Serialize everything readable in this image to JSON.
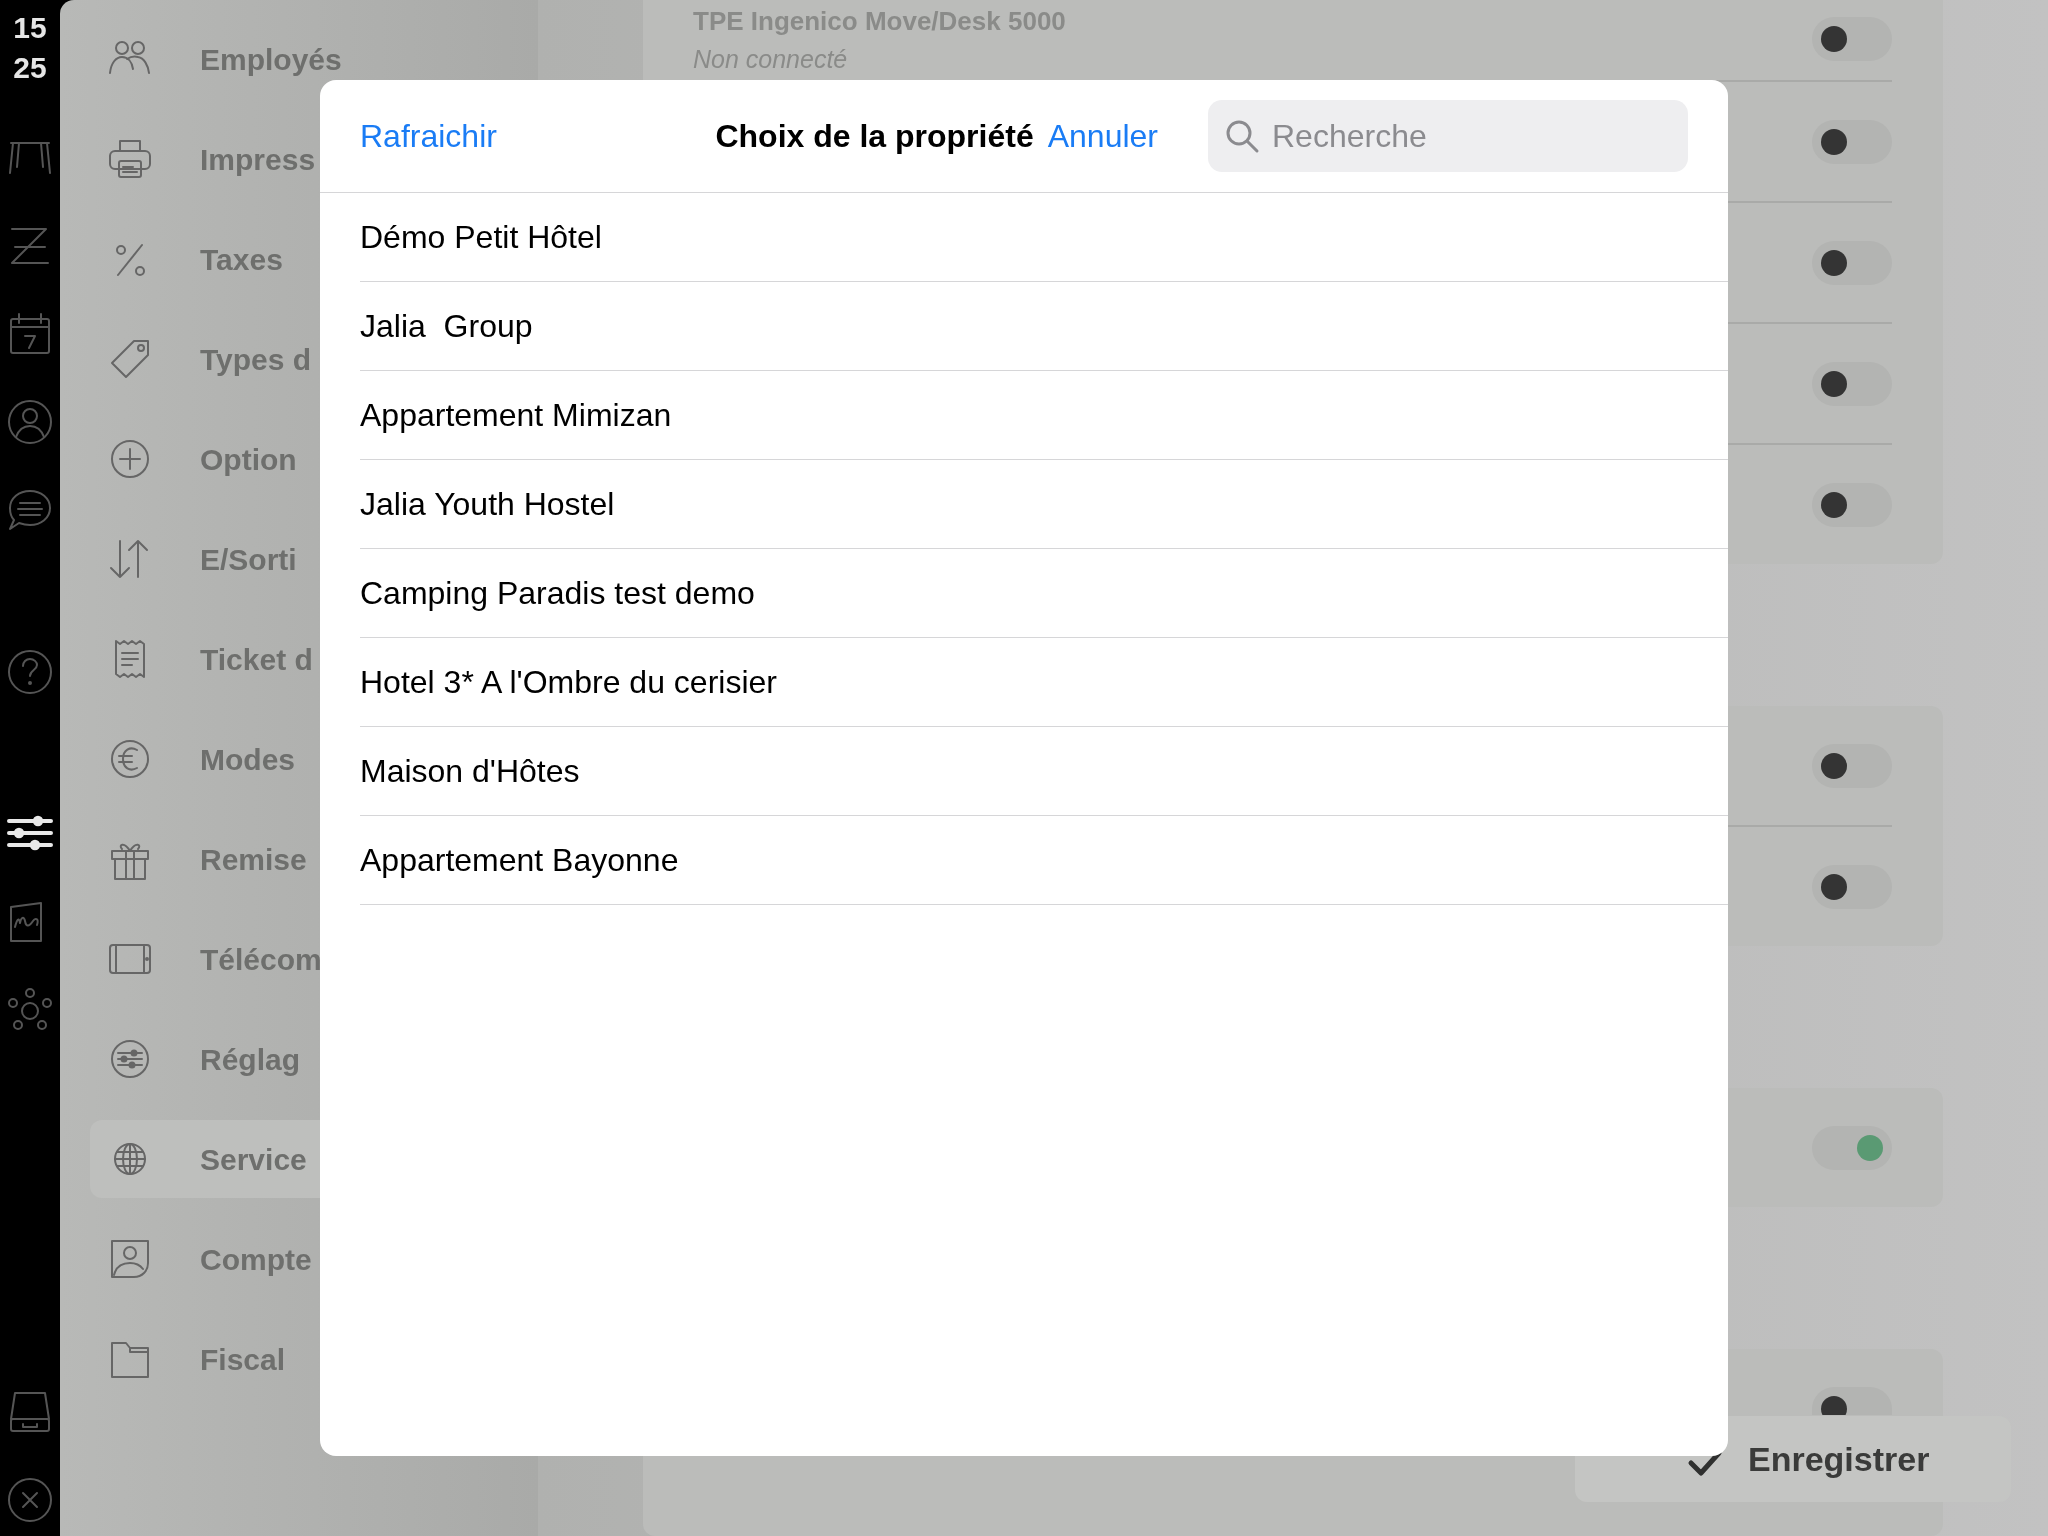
{
  "rail": {
    "clock_hours": "15",
    "clock_minutes": "25",
    "tools": [
      {
        "selected": false
      },
      {
        "selected": false
      },
      {
        "selected": false
      },
      {
        "selected": false
      },
      {
        "selected": false
      },
      {
        "selected": false
      },
      {
        "selected": true
      },
      {
        "selected": false
      },
      {
        "selected": false
      },
      {
        "selected": false
      },
      {
        "selected": false
      }
    ]
  },
  "sidebar": {
    "items": [
      {
        "label": "Employés",
        "selected": false
      },
      {
        "label": "Impress",
        "selected": false
      },
      {
        "label": "Taxes",
        "selected": false
      },
      {
        "label": "Types d",
        "selected": false
      },
      {
        "label": "Option",
        "selected": false
      },
      {
        "label": "E/Sorti",
        "selected": false
      },
      {
        "label": "Ticket d",
        "selected": false
      },
      {
        "label": "Modes",
        "selected": false
      },
      {
        "label": "Remise",
        "selected": false
      },
      {
        "label": "Télécom",
        "selected": false
      },
      {
        "label": "Réglag",
        "selected": false
      },
      {
        "label": "Service",
        "selected": true
      },
      {
        "label": "Compte",
        "selected": false
      },
      {
        "label": "Fiscal",
        "selected": false
      }
    ]
  },
  "settings_cards": [
    {
      "rows": [
        {
          "title": "TPE Ingenico Move/Desk 5000",
          "subtitle": "Non connecté",
          "on": false
        },
        {
          "on": false
        },
        {
          "on": false
        },
        {
          "on": false
        },
        {
          "on": false
        }
      ]
    },
    {
      "rows": [
        {
          "on": false
        },
        {
          "on": false
        }
      ]
    },
    {
      "rows": [
        {
          "on": true
        }
      ]
    },
    {
      "rows": [
        {
          "on": false
        }
      ]
    }
  ],
  "save_button": {
    "label": "Enregistrer"
  },
  "picker": {
    "refresh": "Rafraichir",
    "title": "Choix de la propriété",
    "cancel": "Annuler",
    "search": {
      "placeholder": "Recherche"
    },
    "items": [
      {
        "name": "Démo Petit Hôtel"
      },
      {
        "name": "Jalia  Group"
      },
      {
        "name": "Appartement Mimizan"
      },
      {
        "name": "Jalia Youth Hostel"
      },
      {
        "name": "Camping Paradis test demo"
      },
      {
        "name": "Hotel 3* A l'Ombre du cerisier"
      },
      {
        "name": "Maison d'Hôtes"
      },
      {
        "name": "Appartement Bayonne"
      }
    ]
  }
}
